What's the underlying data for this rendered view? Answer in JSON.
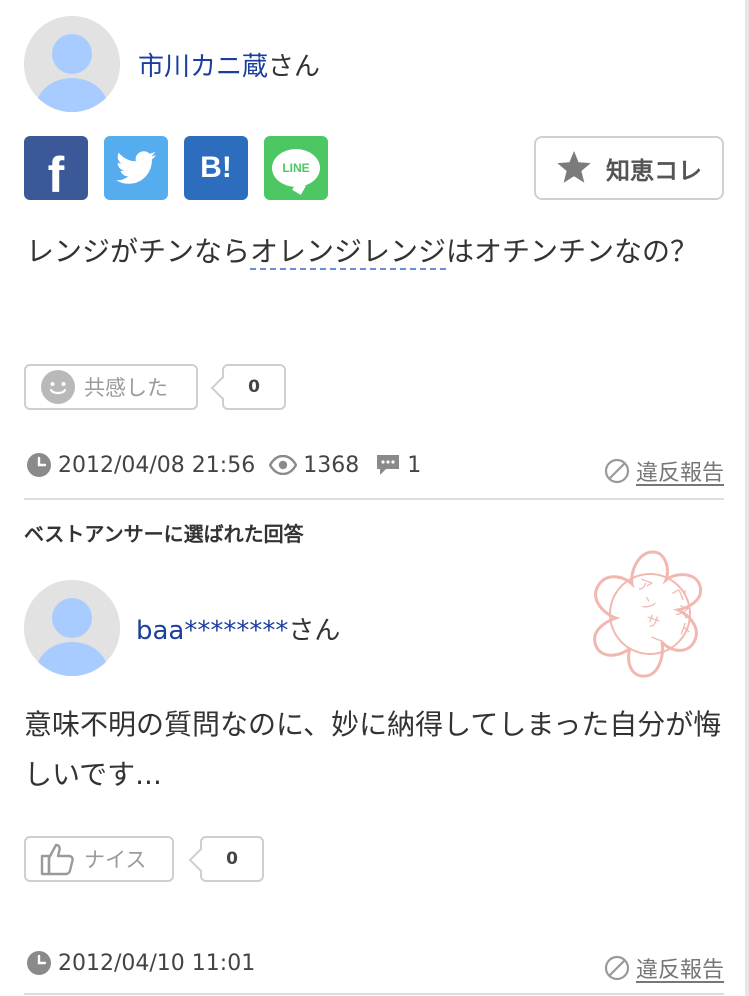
{
  "question": {
    "user_name": "市川カニ蔵",
    "user_suffix": "さん",
    "share": {
      "facebook_label": "f",
      "twitter_icon": "twitter-bird-icon",
      "hatena_label": "B!",
      "line_label": "LINE"
    },
    "chie_button_label": "知恵コレ",
    "text_before": "レンジがチンなら",
    "text_keyword": "オレンジレンジ",
    "text_after": "はオチンチンなの？",
    "empathy_label": "共感した",
    "empathy_count": "0",
    "date": "2012/04/08 21:56",
    "views": "1368",
    "answers": "1",
    "report_label": "違反報告"
  },
  "best_answer": {
    "section_title": "ベストアンサーに選ばれた回答",
    "stamp_text": "ベストアンサー",
    "user_name": "baa********",
    "user_suffix": "さん",
    "text": "意味不明の質問なのに、妙に納得してしまった自分が悔しいです...",
    "nice_label": "ナイス",
    "nice_count": "0",
    "date": "2012/04/10 11:01",
    "report_label": "違反報告"
  },
  "colors": {
    "facebook": "#3b5998",
    "twitter": "#55acee",
    "hatena": "#2c6ebd",
    "line": "#4cc764",
    "username_link": "#1a3e9c",
    "avatar_head": "#a8ccff",
    "stamp": "#f2b8b0"
  }
}
